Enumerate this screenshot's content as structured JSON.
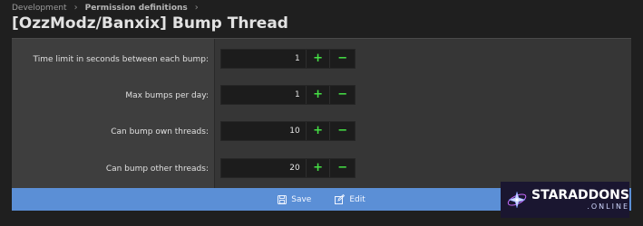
{
  "breadcrumb": {
    "items": [
      "Development",
      "Permission definitions"
    ],
    "separator": "›"
  },
  "page": {
    "title": "[OzzModz/Banxix] Bump Thread"
  },
  "form": {
    "rows": [
      {
        "label": "Time limit in seconds between each bump:",
        "value": "1"
      },
      {
        "label": "Max bumps per day:",
        "value": "1"
      },
      {
        "label": "Can bump own threads:",
        "value": "10"
      },
      {
        "label": "Can bump other threads:",
        "value": "20"
      }
    ],
    "increment_label": "+",
    "decrement_label": "−"
  },
  "footer": {
    "save_label": "Save",
    "edit_label": "Edit",
    "accent_color": "#5b8fd6"
  },
  "watermark": {
    "line1": "STARADDONS",
    "line2": ".ONLINE"
  }
}
